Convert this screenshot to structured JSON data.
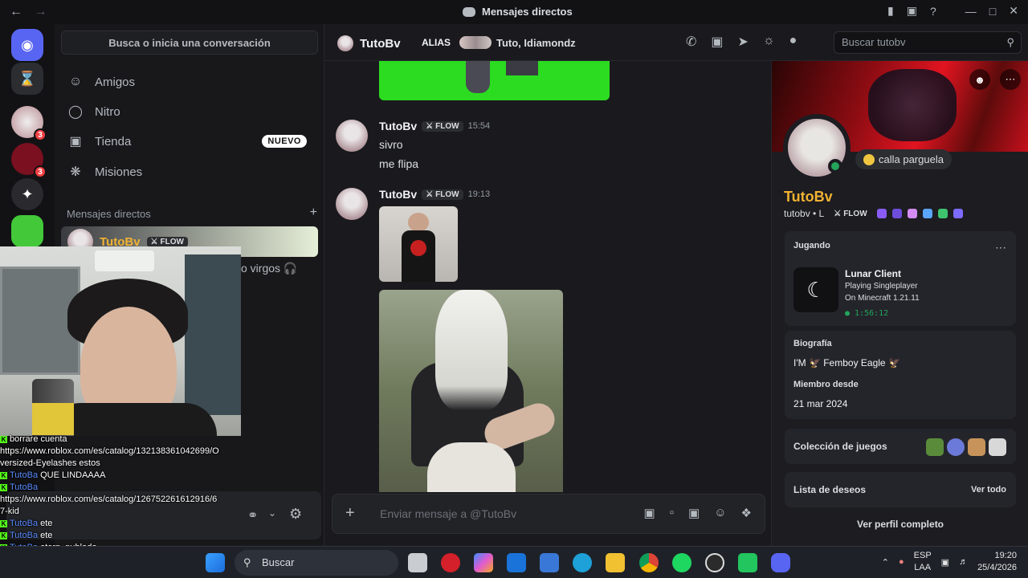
{
  "window": {
    "title": "Mensajes directos",
    "back": "←",
    "forward": "→"
  },
  "dm_panel": {
    "search_placeholder": "Busca o inicia una conversación",
    "nav": [
      {
        "label": "Amigos",
        "icon": "friends-icon"
      },
      {
        "label": "Nitro",
        "icon": "nitro-icon"
      },
      {
        "label": "Tienda",
        "icon": "shop-icon",
        "badge": "NUEVO"
      },
      {
        "label": "Misiones",
        "icon": "quests-icon"
      }
    ],
    "section_title": "Mensajes directos",
    "section_add": "+",
    "selected_dm": {
      "name": "TutoBv",
      "tag": "FLOW"
    },
    "partial_status": "o virgos 🎧"
  },
  "servers": [
    {
      "icon": "discord-home-icon"
    },
    {
      "icon": "hourglass-icon"
    },
    {
      "badge": "3"
    },
    {
      "badge": "3"
    },
    {},
    {}
  ],
  "stream_chat": [
    {
      "user": "",
      "text": "borrare cuenta"
    },
    {
      "user": "",
      "text": "https://www.roblox.com/es/catalog/132138361042699/O"
    },
    {
      "user": "",
      "text": "versized-Eyelashes estos"
    },
    {
      "user": "TutoBa",
      "text": "QUE LINDAAAA"
    },
    {
      "user": "TutoBa",
      "text": ""
    },
    {
      "user": "",
      "text": "https://www.roblox.com/es/catalog/126752261612916/6"
    },
    {
      "user": "",
      "text": "7-kid"
    },
    {
      "user": "TutoBa",
      "text": "ete"
    },
    {
      "user": "TutoBa",
      "text": "ete"
    },
    {
      "user": "TutoBa",
      "text": "etern. nublado"
    }
  ],
  "chat": {
    "header": {
      "name": "TutoBv",
      "alias_label": "ALIAS",
      "members": "Tuto, Idiamondz"
    },
    "search_placeholder": "Buscar tutobv",
    "messages": [
      {
        "author": "TutoBv",
        "tag": "FLOW",
        "time": "15:54",
        "lines": [
          "sivro",
          "me flipa"
        ]
      },
      {
        "author": "TutoBv",
        "tag": "FLOW",
        "time": "19:13",
        "lines": []
      }
    ],
    "composer_placeholder": "Enviar mensaje a @TutoBv",
    "composer_plus": "+"
  },
  "profile": {
    "display_name": "TutoBv",
    "username": "tutobv • L",
    "tag": "FLOW",
    "status_text": "calla parguela",
    "playing_label": "Jugando",
    "game": {
      "title": "Lunar Client",
      "line1": "Playing Singleplayer",
      "line2": "On Minecraft 1.21.11",
      "elapsed": "1:56:12"
    },
    "bio_label": "Biografía",
    "bio_text": "I'M 🦅 Femboy Eagle 🦅",
    "member_since_label": "Miembro desde",
    "member_since": "21 mar 2024",
    "games_collection": "Colección de juegos",
    "wishlist": "Lista de deseos",
    "see_all": "Ver todo",
    "view_full": "Ver perfil completo"
  },
  "taskbar": {
    "search": "Buscar",
    "lang1": "ESP",
    "lang2": "LAA",
    "time": "19:20",
    "date": "25/4/2026"
  },
  "colors": {
    "accent": "#5865f2",
    "name_color": "#f0b232",
    "online": "#23a55a",
    "badge": "#f23f42"
  }
}
